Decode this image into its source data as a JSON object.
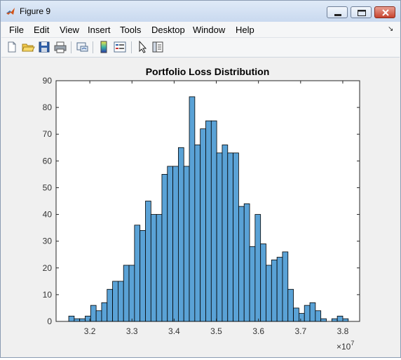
{
  "window": {
    "title": "Figure 9",
    "controls": {
      "minimize": "minimize",
      "maximize": "maximize",
      "close": "close"
    }
  },
  "menu": [
    {
      "label": "File"
    },
    {
      "label": "Edit"
    },
    {
      "label": "View"
    },
    {
      "label": "Insert"
    },
    {
      "label": "Tools"
    },
    {
      "label": "Desktop"
    },
    {
      "label": "Window"
    },
    {
      "label": "Help"
    }
  ],
  "toolbar": {
    "icons": [
      "new-figure-icon",
      "open-file-icon",
      "save-icon",
      "print-icon",
      "link-plot-icon",
      "insert-colorbar-icon",
      "insert-legend-icon",
      "edit-plot-pointer-icon",
      "property-inspector-icon"
    ]
  },
  "chart_data": {
    "type": "bar",
    "title": "Portfolio Loss Distribution",
    "xlabel": "",
    "ylabel": "",
    "x_exponent_label": "×10",
    "x_exponent_power": "7",
    "xlim": [
      31200000,
      38400000
    ],
    "ylim": [
      0,
      90
    ],
    "x_ticks": [
      "3.2",
      "3.3",
      "3.4",
      "3.5",
      "3.6",
      "3.7",
      "3.8"
    ],
    "x_tick_values": [
      32000000,
      33000000,
      34000000,
      35000000,
      36000000,
      37000000,
      38000000
    ],
    "y_ticks": [
      "0",
      "10",
      "20",
      "30",
      "40",
      "50",
      "60",
      "70",
      "80",
      "90"
    ],
    "y_tick_values": [
      0,
      10,
      20,
      30,
      40,
      50,
      60,
      70,
      80,
      90
    ],
    "bin_start": 31500000,
    "bin_width": 130000,
    "bar_color": "#5aa2d6",
    "edge_color": "#000000",
    "values": [
      2,
      1,
      1,
      2,
      6,
      4,
      7,
      12,
      15,
      15,
      21,
      21,
      36,
      34,
      45,
      40,
      40,
      55,
      58,
      58,
      65,
      58,
      84,
      66,
      72,
      75,
      75,
      63,
      66,
      63,
      63,
      43,
      44,
      28,
      40,
      29,
      21,
      23,
      24,
      26,
      12,
      5,
      3,
      6,
      7,
      4,
      1,
      0,
      1,
      2,
      1
    ]
  }
}
